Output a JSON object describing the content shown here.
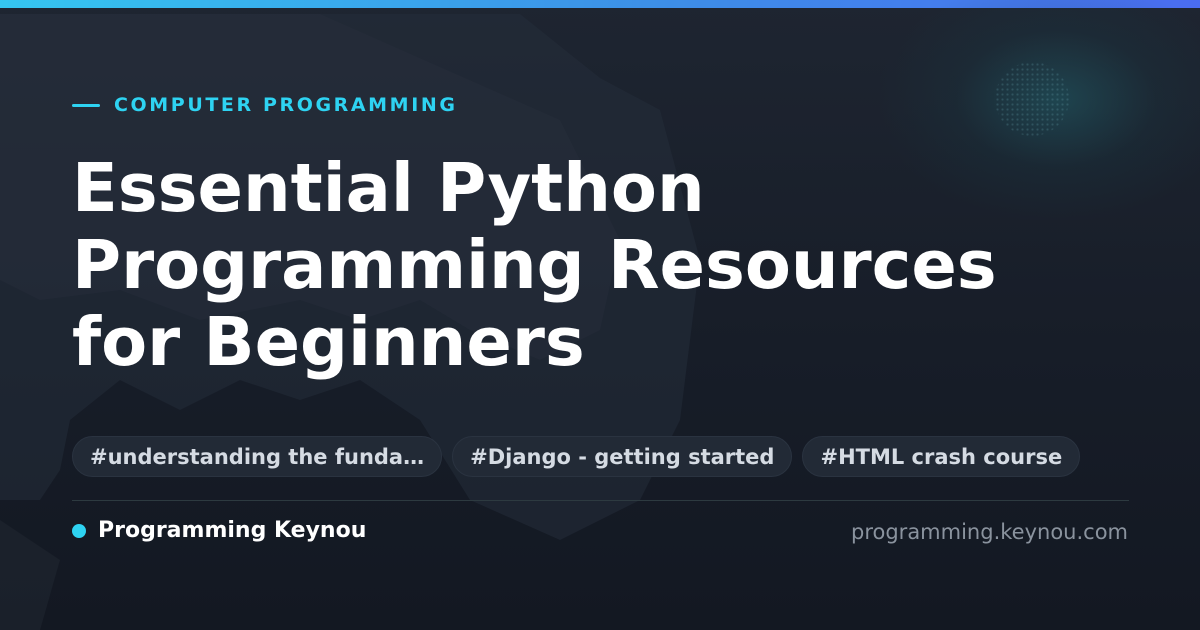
{
  "theme": {
    "accent": "#2ed3f2",
    "accent_bar_start": "#35c6f0",
    "accent_bar_end": "#4a6cf0",
    "background": "#1a202b",
    "title_color": "#ffffff",
    "tag_text_color": "#d5dbe3",
    "url_color": "#8a939e"
  },
  "eyebrow": {
    "label": "COMPUTER PROGRAMMING"
  },
  "title": {
    "line1": "Essential Python",
    "line2": "Programming Resources",
    "line3": "for Beginners"
  },
  "tags": [
    {
      "label": "#understanding the funda…"
    },
    {
      "label": "#Django - getting started"
    },
    {
      "label": "#HTML crash course"
    }
  ],
  "footer": {
    "brand_name": "Programming Keynou",
    "site_url": "programming.keynou.com"
  }
}
